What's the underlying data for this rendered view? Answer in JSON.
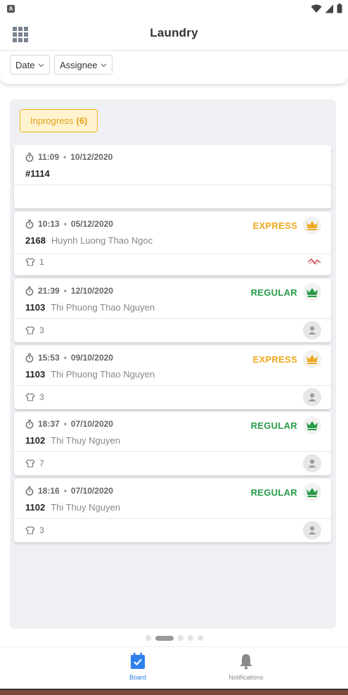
{
  "header": {
    "title": "Laundry"
  },
  "filters": [
    {
      "label": "Date"
    },
    {
      "label": "Assignee"
    }
  ],
  "column": {
    "name": "Inprogress",
    "count": "(6)"
  },
  "cards": [
    {
      "time": "11:09",
      "date": "10/12/2020",
      "order": "#1114",
      "customer": "",
      "service": "",
      "quantity": ""
    },
    {
      "time": "10:13",
      "date": "05/12/2020",
      "order": "2168",
      "customer": "Huynh Luong Thao Ngoc",
      "service": "EXPRESS",
      "quantity": "1"
    },
    {
      "time": "21:39",
      "date": "12/10/2020",
      "order": "1103",
      "customer": "Thi Phuong Thao Nguyen",
      "service": "REGULAR",
      "quantity": "3"
    },
    {
      "time": "15:53",
      "date": "09/10/2020",
      "order": "1103",
      "customer": "Thi Phuong Thao Nguyen",
      "service": "EXPRESS",
      "quantity": "3"
    },
    {
      "time": "18:37",
      "date": "07/10/2020",
      "order": "1102",
      "customer": "Thi Thuy Nguyen",
      "service": "REGULAR",
      "quantity": "7"
    },
    {
      "time": "18:16",
      "date": "07/10/2020",
      "order": "1102",
      "customer": "Thi Thuy Nguyen",
      "service": "REGULAR",
      "quantity": "3"
    }
  ],
  "separator": "•",
  "pager": {
    "pages": 5,
    "active": 1
  },
  "nav": {
    "board_label": "Board",
    "notifications_label": "Notifications"
  },
  "colors": {
    "express": "#f0a81e",
    "regular": "#2a9d4a",
    "nav_active": "#2f80ed",
    "nav_inactive": "#8a8a8a"
  },
  "icons": {
    "menu": "grid-icon",
    "timer": "stopwatch-icon",
    "crown": "crown-icon",
    "garment": "shirt-icon",
    "assignee": "user-icon",
    "board": "checkbox-icon",
    "notifications": "bell-icon"
  }
}
